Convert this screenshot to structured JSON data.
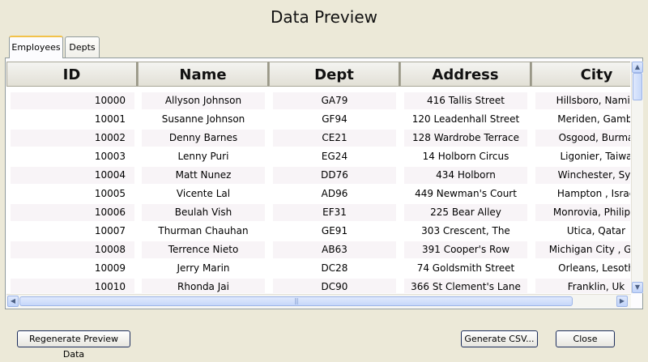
{
  "window": {
    "title": "Data Preview"
  },
  "tabs": [
    {
      "label": "Employees",
      "active": true
    },
    {
      "label": "Depts",
      "active": false
    }
  ],
  "table": {
    "columns": [
      "ID",
      "Name",
      "Dept",
      "Address",
      "City"
    ],
    "rows": [
      {
        "id": "10000",
        "name": "Allyson Johnson",
        "dept": "GA79",
        "address": "416 Tallis Street",
        "city": "Hillsboro, Namib"
      },
      {
        "id": "10001",
        "name": "Susanne Johnson",
        "dept": "GF94",
        "address": "120 Leadenhall Street",
        "city": "Meriden, Gambi"
      },
      {
        "id": "10002",
        "name": "Denny Barnes",
        "dept": "CE21",
        "address": "128 Wardrobe Terrace",
        "city": "Osgood, Burma"
      },
      {
        "id": "10003",
        "name": "Lenny Puri",
        "dept": "EG24",
        "address": "14 Holborn Circus",
        "city": "Ligonier, Taiwa"
      },
      {
        "id": "10004",
        "name": "Matt Nunez",
        "dept": "DD76",
        "address": "434 Holborn",
        "city": "Winchester, Syr"
      },
      {
        "id": "10005",
        "name": "Vicente Lal",
        "dept": "AD96",
        "address": "449 Newman's Court",
        "city": "Hampton , Israe"
      },
      {
        "id": "10006",
        "name": "Beulah Vish",
        "dept": "EF31",
        "address": "225 Bear Alley",
        "city": "Monrovia, Philippi"
      },
      {
        "id": "10007",
        "name": "Thurman Chauhan",
        "dept": "GE91",
        "address": "303 Crescent, The",
        "city": "Utica, Qatar"
      },
      {
        "id": "10008",
        "name": "Terrence Nieto",
        "dept": "AB63",
        "address": "391 Cooper's Row",
        "city": "Michigan City , Guy"
      },
      {
        "id": "10009",
        "name": "Jerry Marin",
        "dept": "DC28",
        "address": "74 Goldsmith Street",
        "city": "Orleans, Lesoth"
      },
      {
        "id": "10010",
        "name": "Rhonda Jai",
        "dept": "DC90",
        "address": "366 St Clement's Lane",
        "city": "Franklin, Uk"
      }
    ]
  },
  "buttons": {
    "regenerate": "Regenerate Preview Data",
    "generate_csv": "Generate CSV...",
    "close": "Close"
  },
  "scrollbars": {
    "up_icon": "scroll-up-arrow",
    "down_icon": "scroll-down-arrow",
    "left_icon": "scroll-left-arrow",
    "right_icon": "scroll-right-arrow"
  }
}
